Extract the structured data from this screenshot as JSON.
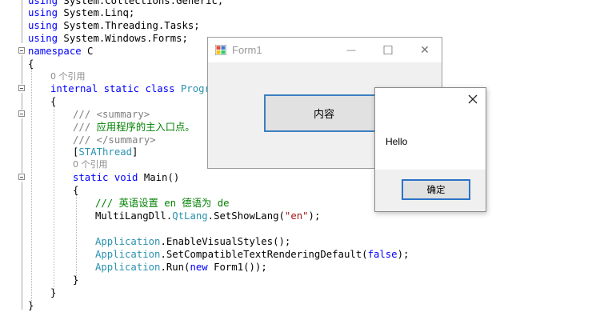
{
  "editor": {
    "lines": {
      "l0": {
        "kw": "using",
        "rest": " System.Collections.Generic;"
      },
      "l1": {
        "kw": "using",
        "rest": " System.Linq;"
      },
      "l2": {
        "kw": "using",
        "rest": " System.Threading.Tasks;"
      },
      "l3": {
        "kw": "using",
        "rest": " System.Windows.Forms;"
      },
      "l4": {
        "kw": "namespace",
        "rest": " C"
      },
      "l5": "{",
      "l6": "0 个引用",
      "l7": {
        "kw": "internal static class",
        "ty": " Progra"
      },
      "l8": "{",
      "l9": {
        "gr": "/// <summary>"
      },
      "l10": {
        "gr": "/// ",
        "cm": "应用程序的主入口点。"
      },
      "l11": {
        "gr": "/// </summary>"
      },
      "l12": {
        "p1": "[",
        "ty": "STAThread",
        "p2": "]"
      },
      "l13": "0 个引用",
      "l14": {
        "kw": "static void",
        "rest": " Main()"
      },
      "l15": "{",
      "l16": {
        "cm": "/// 英语设置 en 德语为 de"
      },
      "l17": {
        "a": "MultiLangDll.",
        "ty": "QtLang",
        "b": ".SetShowLang(",
        "st": "\"en\"",
        "c": ");"
      },
      "l19": {
        "ty": "Application",
        "rest": ".EnableVisualStyles();"
      },
      "l20": {
        "ty": "Application",
        "a": ".SetCompatibleTextRenderingDefault(",
        "kw": "false",
        "b": ");"
      },
      "l21": {
        "ty": "Application",
        "a": ".Run(",
        "kw": "new",
        "b": " Form1());"
      },
      "l22": "}",
      "l23": "}",
      "l24": "}"
    }
  },
  "form1": {
    "title": "Form1",
    "icon": "winforms-app-icon",
    "minimize_glyph": "—",
    "maximize_glyph": "☐",
    "close_glyph": "✕",
    "content_button_label": "内容"
  },
  "messagebox": {
    "message": "Hello",
    "ok_label": "确定",
    "close_icon": "close-icon"
  },
  "colors": {
    "keyword": "#0000ff",
    "type": "#2b91af",
    "comment": "#008000",
    "doc_gray": "#808080",
    "string": "#a31515",
    "focus_border": "#2b73c8"
  }
}
